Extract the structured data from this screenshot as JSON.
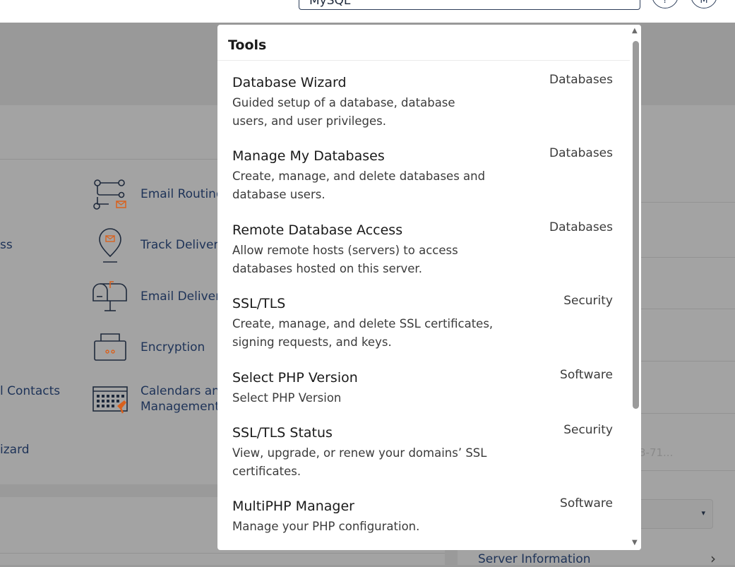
{
  "header": {
    "search": {
      "value": "MySQL",
      "clear_icon": "×"
    },
    "buttons": [
      {
        "icon": "?",
        "name": "help-icon"
      },
      {
        "icon": "M",
        "name": "user-menu-icon"
      }
    ]
  },
  "background": {
    "left_fragments": {
      "ss": "ss",
      "contacts": "l Contacts",
      "wizard": "izard"
    },
    "email_tools": [
      {
        "label": "Email Routing",
        "icon": "routing-icon"
      },
      {
        "label": "Track Delivery",
        "icon": "track-delivery-icon"
      },
      {
        "label": "Email Delivera",
        "icon": "mailbox-icon"
      },
      {
        "label": "Encryption",
        "icon": "encryption-icon"
      },
      {
        "label_line1": "Calendars and",
        "label_line2": "Management",
        "icon": "calendar-icon"
      }
    ],
    "right_faded_text": "3-71...",
    "server_information": "Server Information",
    "select_arrow": "▾",
    "chevron": "›"
  },
  "tools_dropdown": {
    "title": "Tools",
    "items": [
      {
        "name": "Database Wizard",
        "description": "Guided setup of a database, database users, and user privileges.",
        "category": "Databases"
      },
      {
        "name": "Manage My Databases",
        "description": "Create, manage, and delete databases and database users.",
        "category": "Databases"
      },
      {
        "name": "Remote Database Access",
        "description": "Allow remote hosts (servers) to access databases hosted on this server.",
        "category": "Databases"
      },
      {
        "name": "SSL/TLS",
        "description": "Create, manage, and delete SSL certificates, signing requests, and keys.",
        "category": "Security"
      },
      {
        "name": "Select PHP Version",
        "description": "Select PHP Version",
        "category": "Software"
      },
      {
        "name": "SSL/TLS Status",
        "description": "View, upgrade, or renew your domains’ SSL certificates.",
        "category": "Security"
      },
      {
        "name": "MultiPHP Manager",
        "description": "Manage your PHP configuration.",
        "category": "Software"
      }
    ],
    "scroll_up": "▲",
    "scroll_down": "▼"
  },
  "colors": {
    "overlay": "#9a9a9a",
    "link": "#1e3358",
    "accent": "#d9611d"
  }
}
